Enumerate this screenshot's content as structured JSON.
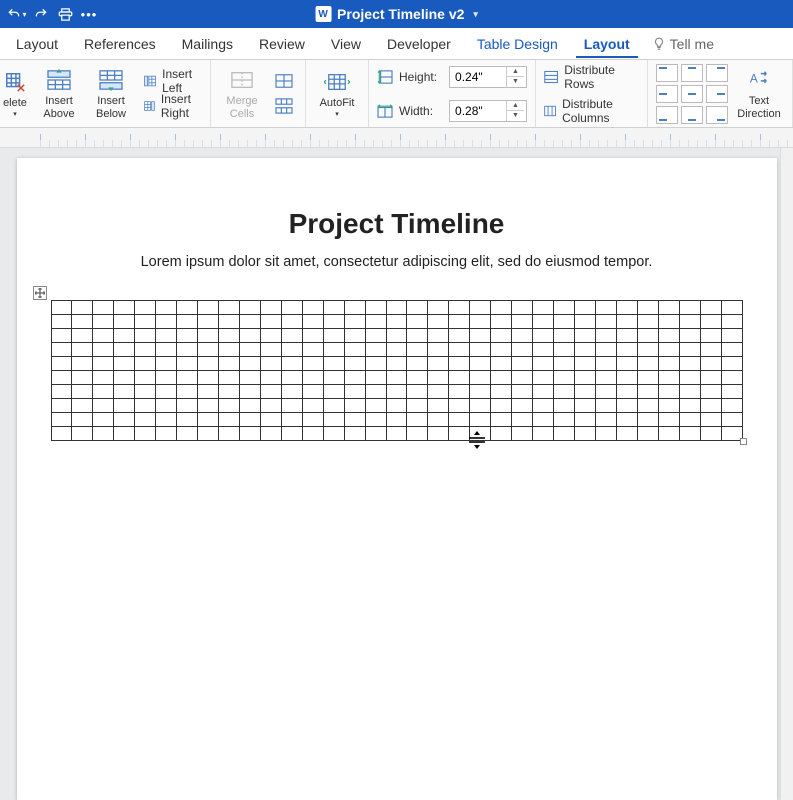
{
  "titlebar": {
    "document_name": "Project Timeline v2"
  },
  "tabs": {
    "items": [
      "Layout",
      "References",
      "Mailings",
      "Review",
      "View",
      "Developer",
      "Table Design",
      "Layout"
    ],
    "context_start_index": 6,
    "active_index": 7,
    "tell_me": "Tell me"
  },
  "ribbon": {
    "delete": "elete",
    "insert_above": "Insert\nAbove",
    "insert_below": "Insert\nBelow",
    "insert_left": "Insert Left",
    "insert_right": "Insert Right",
    "merge_cells": "Merge\nCells",
    "autofit": "AutoFit",
    "height_label": "Height:",
    "height_value": "0.24\"",
    "width_label": "Width:",
    "width_value": "0.28\"",
    "distribute_rows": "Distribute Rows",
    "distribute_columns": "Distribute Columns",
    "text_direction": "Text\nDirection"
  },
  "document": {
    "title": "Project Timeline",
    "subtitle": "Lorem ipsum dolor sit amet, consectetur adipiscing elit, sed do eiusmod tempor.",
    "table": {
      "rows": 10,
      "cols": 33
    }
  }
}
